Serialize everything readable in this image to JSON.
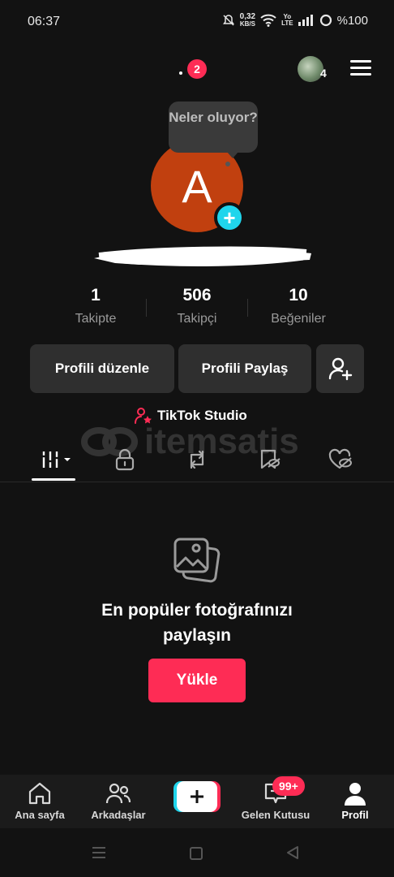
{
  "status_bar": {
    "time": "06:37",
    "speed_value": "0,32",
    "speed_unit": "KB/S",
    "volte_top": "Yo",
    "volte_bottom": "LTE",
    "battery": "%100"
  },
  "top_bar": {
    "notification_count": "2",
    "account_count": "4"
  },
  "profile": {
    "tooltip": "Neler oluyor?",
    "avatar_letter": "A",
    "add_symbol": "+"
  },
  "stats": [
    {
      "value": "1",
      "label": "Takipte"
    },
    {
      "value": "506",
      "label": "Takipçi"
    },
    {
      "value": "10",
      "label": "Beğeniler"
    }
  ],
  "actions": {
    "edit_profile": "Profili düzenle",
    "share_profile": "Profili Paylaş"
  },
  "studio_label": "TikTok Studio",
  "watermark": "itemsatis",
  "empty_state": {
    "title_line1": "En popüler fotoğrafınızı",
    "title_line2": "paylaşın",
    "upload_label": "Yükle"
  },
  "bottom_nav": {
    "home": "Ana sayfa",
    "friends": "Arkadaşlar",
    "inbox": "Gelen Kutusu",
    "inbox_badge": "99+",
    "profile": "Profil",
    "create_symbol": "+"
  },
  "colors": {
    "accent": "#fe2c55",
    "cyan": "#20d5ec",
    "avatar": "#c1400f",
    "background": "#121212"
  }
}
